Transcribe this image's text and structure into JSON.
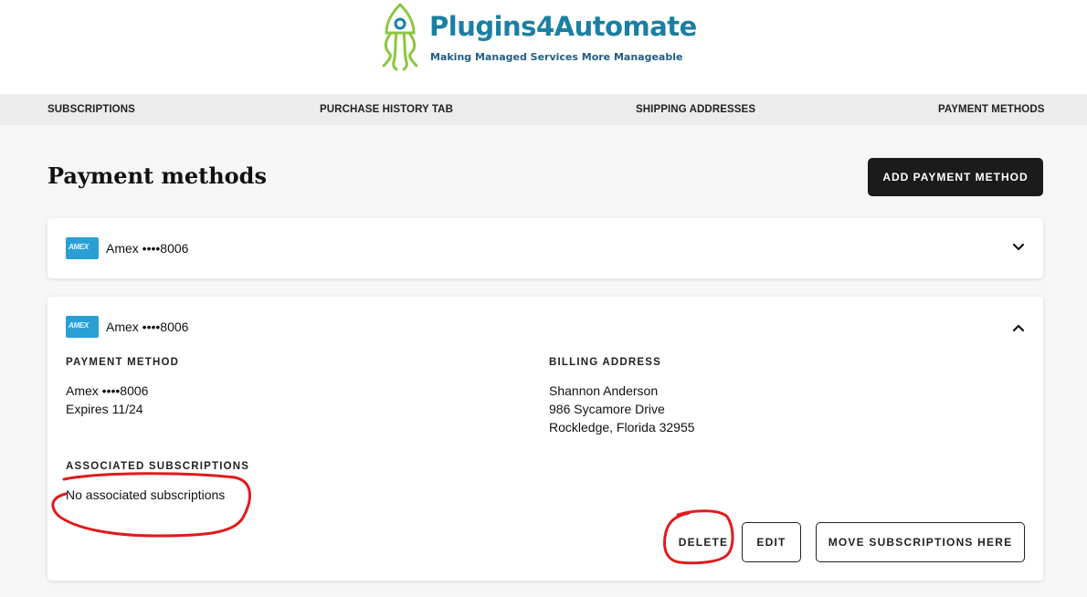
{
  "brand": {
    "title": "Plugins4Automate",
    "tagline": "Making Managed Services More Manageable",
    "title_color": "#1a7fa3",
    "logo_green": "#8cc63f"
  },
  "nav": {
    "subscriptions": "SUBSCRIPTIONS",
    "purchase_history": "PURCHASE HISTORY TAB",
    "shipping_addresses": "SHIPPING ADDRESSES",
    "payment_methods": "PAYMENT METHODS"
  },
  "page": {
    "title": "Payment methods",
    "add_button": "ADD PAYMENT METHOD"
  },
  "cards": [
    {
      "brand_icon": "AMEX",
      "label": "Amex ••••8006",
      "expanded": false
    },
    {
      "brand_icon": "AMEX",
      "label": "Amex ••••8006",
      "expanded": true,
      "payment_method_heading": "PAYMENT METHOD",
      "card_line": "Amex ••••8006",
      "expires": "Expires 11/24",
      "billing_heading": "BILLING ADDRESS",
      "billing_name": "Shannon Anderson",
      "billing_street": "986 Sycamore Drive",
      "billing_city": "Rockledge, Florida 32955",
      "subs_heading": "ASSOCIATED SUBSCRIPTIONS",
      "subs_text": "No associated subscriptions",
      "delete_label": "DELETE",
      "edit_label": "EDIT",
      "move_label": "MOVE SUBSCRIPTIONS HERE"
    }
  ],
  "colors": {
    "amex_blue": "#2a9fd6",
    "annotation_red": "#e01b1b",
    "dark_button": "#1b1b1b"
  }
}
